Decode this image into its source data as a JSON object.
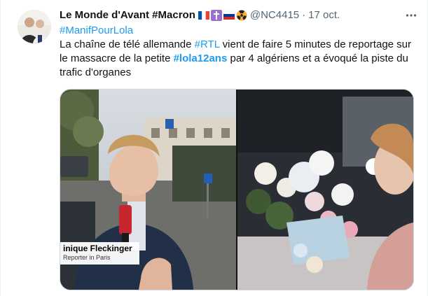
{
  "tweet": {
    "author": {
      "display_name": "Le Monde d'Avant #Macron",
      "handle": "@NC4415",
      "emojis": [
        "france-flag-icon",
        "latin-cross-icon",
        "russia-flag-icon",
        "radioactive-icon"
      ]
    },
    "separator": "·",
    "date": "17 oct.",
    "text": {
      "line1_hashtag": "#ManifPourLola",
      "part1": "La chaîne de télé allemande ",
      "hashtag_rtl": "#RTL",
      "part2": " vient de faire 5 minutes de reportage sur le massacre de la petite ",
      "hashtag_lola": "#lola12ans",
      "part3": " par 4 algériens et a évoqué la piste du trafic d'organes"
    },
    "media": {
      "video_still": {
        "lower_third_name": "inique Fleckinger",
        "lower_third_role": "Reporter in Paris"
      }
    },
    "colors": {
      "link": "#1d9bf0",
      "text": "#0f1419",
      "secondary": "#536471",
      "border": "#cfd9de"
    }
  }
}
